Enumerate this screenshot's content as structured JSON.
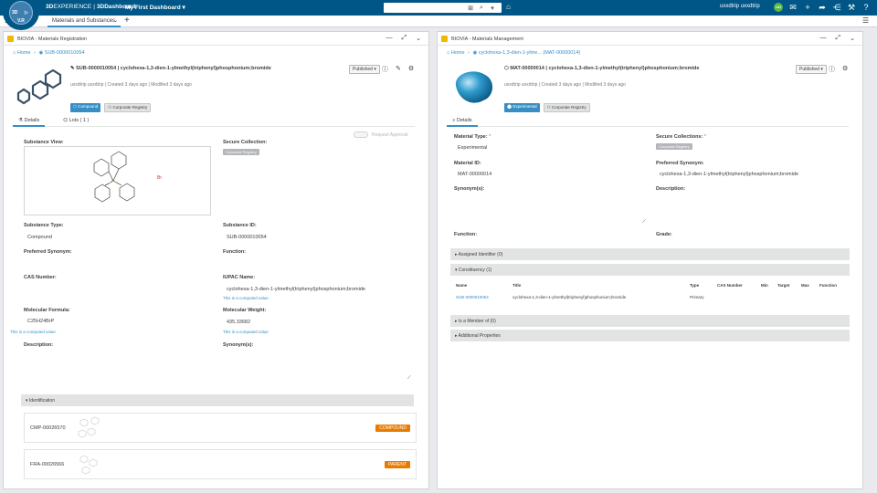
{
  "app": {
    "brand_3d": "3D",
    "brand_experience": "EXPERIENCE",
    "brand_separator": "|",
    "brand_product": "3DDashboard",
    "dashboard_title": "My First Dashboard",
    "compass_q1": "3D",
    "compass_q2": "V.R",
    "user_name": "uxxdtrip uxxdtrip",
    "avatar_initials": "UU"
  },
  "tabbar": {
    "tab_label": "Materials and Substances"
  },
  "left_panel": {
    "title": "BIOVIA - Materials Registration",
    "breadcrumb_home": "Home",
    "breadcrumb_item": "SUB-0000010054",
    "object_title": "SUB-0000010054 | cyclohexa-1,3-dien-1-ylmethyl(triphenyl)phosphonium;bromide",
    "meta": "uxxdtrip uxxdtrip | Created 3 days ago | Modified 3 days ago",
    "tag_type": "Compound",
    "tag_collection": "Corporate Registry",
    "status": "Published",
    "tabs": [
      "Details",
      "Lots ( 1 )"
    ],
    "toggle_label": "Request Approval",
    "fields": {
      "substance_view_label": "Substance View:",
      "secure_collection_label": "Secure Collection:",
      "secure_collection_value": "Corporate Registry",
      "substance_type_label": "Substance Type:",
      "substance_type_value": "Compound",
      "substance_id_label": "Substance ID:",
      "substance_id_value": "SUB-0000010054",
      "preferred_synonym_label": "Preferred Synonym:",
      "function_label": "Function:",
      "cas_label": "CAS Number:",
      "iupac_label": "IUPAC Name:",
      "iupac_value": "cyclohexa-1,3-dien-1-ylmethyl(triphenyl)phosphonium;bromide",
      "computed_hint": "This is a computed value",
      "formula_label": "Molecular Formula:",
      "formula_value": "C25H24BrP",
      "weight_label": "Molecular Weight:",
      "weight_value": "435.33682",
      "description_label": "Description:",
      "synonyms_label": "Synonym(s):",
      "bromide_label": "Br"
    },
    "identification_section": "Identification",
    "identifications": [
      {
        "id": "CMP-00026570",
        "badge": "COMPOUND"
      },
      {
        "id": "FRA-00026566",
        "badge": "PARENT"
      }
    ]
  },
  "right_panel": {
    "title": "BIOVIA - Materials Management",
    "breadcrumb_home": "Home",
    "breadcrumb_item": "cyclohexa-1,3-dien-1-ylme... (MAT-00000014)",
    "object_title": "MAT-00000014 | cyclohexa-1,3-dien-1-ylmethyl(triphenyl)phosphonium;bromide",
    "meta": "uxxdtrip uxxdtrip | Created 3 days ago | Modified 3 days ago",
    "tag_type": "Experimental",
    "tag_collection": "Corporate Registry",
    "status": "Published",
    "tabs": [
      "Details"
    ],
    "fields": {
      "material_type_label": "Material Type:",
      "material_type_value": "Experimental",
      "secure_collections_label": "Secure Collections:",
      "secure_collections_value": "Corporate Registry",
      "material_id_label": "Material ID:",
      "material_id_value": "MAT-00000014",
      "preferred_synonym_label": "Preferred Synonym:",
      "preferred_synonym_value": "cyclohexa-1,3-dien-1-ylmethyl(triphenyl)phosphonium;bromide",
      "synonyms_label": "Synonym(s):",
      "description_label": "Description:",
      "function_label": "Function:",
      "grade_label": "Grade:"
    },
    "sections": {
      "assigned_identifier": "Assigned Identifier (0)",
      "constituency": "Constituency (1)",
      "member_of": "Is a Member of (0)",
      "additional": "Additional Properties"
    },
    "table": {
      "headers": [
        "Name",
        "Title",
        "Type",
        "CAS Number",
        "Min",
        "Target",
        "Max",
        "Function"
      ],
      "rows": [
        [
          "SUB-0000010054",
          "cyclohexa-1,3-dien-1-ylmethyl(triphenyl)phosphonium;bromide",
          "Primary",
          "",
          "",
          "",
          "",
          ""
        ]
      ]
    }
  },
  "colors": {
    "topbar": "#005686",
    "accent": "#368ec4",
    "badge_orange": "#e87b00",
    "avatar_green": "#57b847"
  }
}
